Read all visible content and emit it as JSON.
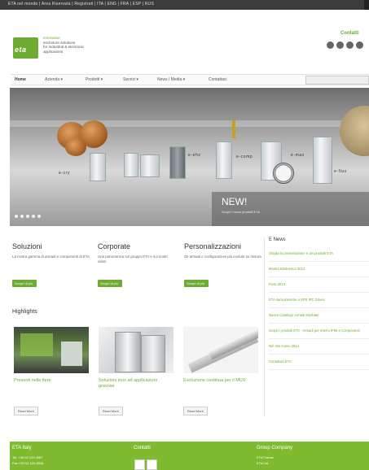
{
  "topbar": {
    "text": "ETA nel mondo | Area Riservata | Registrati | ITA | ENG | FRA | ESP | RUS"
  },
  "brand": {
    "logo_text": "eta",
    "tagline_l1": "innovative",
    "tagline_l2": "enclosure solutions",
    "tagline_l3": "for industrial & electronic",
    "tagline_l4": "applications"
  },
  "header": {
    "contacts": "Contatti",
    "social_icons": [
      "social-icon-1",
      "social-icon-2",
      "social-icon-3",
      "social-icon-4"
    ]
  },
  "nav": {
    "items": [
      {
        "label": "Home",
        "active": true
      },
      {
        "label": "Azienda ▾"
      },
      {
        "label": "Prodotti ▾"
      },
      {
        "label": "Servizi ▾"
      },
      {
        "label": "News / Media ▾"
      },
      {
        "label": "Contattaci"
      }
    ]
  },
  "hero": {
    "products": [
      "e-cry",
      "e-ehs",
      "e-comp",
      "e-max",
      "e-flux"
    ],
    "new_title": "NEW!",
    "new_sub": "Scopri i nuovi prodotti ETA"
  },
  "columns": [
    {
      "title": "Soluzioni",
      "text": "La nostra gamma di armadi e componenti di ETA",
      "button": "Scopri di più"
    },
    {
      "title": "Corporate",
      "text": "Una panoramica sul gruppo ETA e sui nostri valori",
      "button": "Scopri di più"
    },
    {
      "title": "Personalizzazioni",
      "text": "Gli armadi e configurazioni più evolute su misura",
      "button": "Scopri di più"
    }
  ],
  "news": {
    "title": "E News",
    "items": [
      "Sfoglia la presentazione e dei prodotti ETA",
      "Mostra Elettronica 2014",
      "Fiera 2014",
      "ETA sarà presente a SPS IPC Drives",
      "Nuovo Catalogo Armadi Modulari",
      "Scopri i prodotti ETA - Armadi per Interni IP55 e Componenti",
      "Nel sito nuovo 2014",
      "Contattaci ETA"
    ]
  },
  "highlights": {
    "title": "Highlights",
    "cards": [
      {
        "caption": "Presenti nelle fiere",
        "button": "Read More"
      },
      {
        "caption": "Soluzioni inox ad applicazioni gravose",
        "button": "Read More"
      },
      {
        "caption": "Evoluzione continua per il MUX",
        "button": "Read More"
      }
    ]
  },
  "footer": {
    "col1_title": "ETA Italy",
    "col1_l1": "Tel. +39 02 123 4567",
    "col1_l2": "Fax +39 02 123 4568",
    "col2_title": "Contatti",
    "col3_title": "Group Company",
    "col3_l1": "ETA France",
    "col3_l2": "ETA Ltd."
  }
}
